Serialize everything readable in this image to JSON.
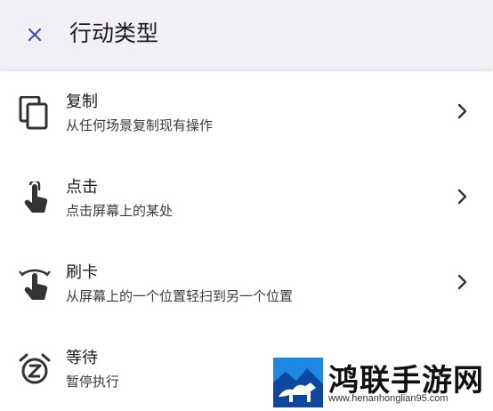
{
  "appbar": {
    "title": "行动类型",
    "close_icon": "close-icon"
  },
  "items": [
    {
      "title": "复制",
      "subtitle": "从任何场景复制现有操作",
      "icon": "copy-icon"
    },
    {
      "title": "点击",
      "subtitle": "点击屏幕上的某处",
      "icon": "tap-icon"
    },
    {
      "title": "刷卡",
      "subtitle": "从屏幕上的一个位置轻扫到另一个位置",
      "icon": "swipe-icon"
    },
    {
      "title": "等待",
      "subtitle": "暂停执行",
      "icon": "alarm-snooze-icon"
    }
  ],
  "watermark": {
    "text": "鸿联手游网",
    "url": "www.henanhonglian95.com"
  },
  "colors": {
    "appbar_bg": "#f3eff6",
    "accent": "#3f51b5",
    "text": "#1c1b1f"
  }
}
